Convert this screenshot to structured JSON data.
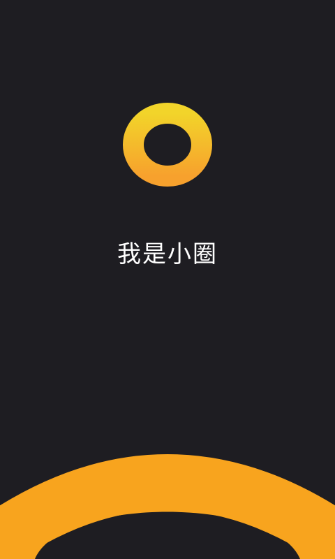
{
  "app": {
    "tagline": "我是小圈"
  },
  "logo": {
    "icon": "ring-logo-icon",
    "gradient_top": "#f2d42a",
    "gradient_bottom": "#f7a12d"
  },
  "decoration": {
    "icon": "orange-arc-icon",
    "color": "#f8a41e"
  },
  "colors": {
    "background": "#1e1d22",
    "text": "#ffffff"
  }
}
